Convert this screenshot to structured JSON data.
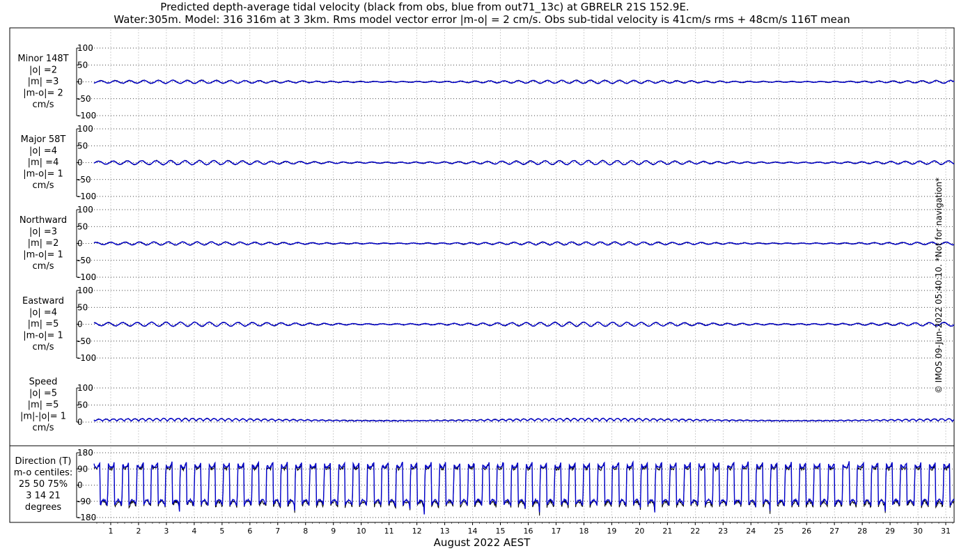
{
  "header": {
    "title": "Predicted depth-average tidal velocity (black from obs, blue from out71_13c) at GBRELR 21S 152.9E.",
    "subtitle": "Water:305m. Model: 316 316m at 3 3km. Rms model vector error |m-o| = 2 cm/s. Obs sub-tidal velocity is 41cm/s rms + 48cm/s 116T mean"
  },
  "footer": {
    "xlabel": "August 2022 AEST",
    "copyright": "© IMOS 09-Jun-2022 05:40:10. *Not for navigation*"
  },
  "colors": {
    "observed": "#000000",
    "model": "#0000cc",
    "grid": "#b0b0b0"
  },
  "chart_data": [
    {
      "type": "line",
      "id": "minor",
      "label_lines": [
        "Minor 148T",
        "|o| =2",
        "|m| =3",
        "|m-o|= 2",
        "cm/s"
      ],
      "yticks": [
        "100",
        "50",
        "0",
        "-50",
        "-100"
      ],
      "ytick_values": [
        100,
        50,
        0,
        -50,
        -100
      ],
      "ylim": [
        -100,
        100
      ],
      "amplitude": 3,
      "series": [
        {
          "role": "observed"
        },
        {
          "role": "model"
        }
      ]
    },
    {
      "type": "line",
      "id": "major",
      "label_lines": [
        "Major 58T",
        "|o| =4",
        "|m| =4",
        "|m-o|= 1",
        "cm/s"
      ],
      "yticks": [
        "100",
        "50",
        "0",
        "-50",
        "-100"
      ],
      "ytick_values": [
        100,
        50,
        0,
        -50,
        -100
      ],
      "ylim": [
        -100,
        100
      ],
      "amplitude": 4,
      "series": [
        {
          "role": "observed"
        },
        {
          "role": "model"
        }
      ]
    },
    {
      "type": "line",
      "id": "northward",
      "label_lines": [
        "Northward",
        "|o| =3",
        "|m| =2",
        "|m-o|= 1",
        "cm/s"
      ],
      "yticks": [
        "100",
        "50",
        "0",
        "-50",
        "-100"
      ],
      "ytick_values": [
        100,
        50,
        0,
        -50,
        -100
      ],
      "ylim": [
        -100,
        100
      ],
      "amplitude": 3,
      "series": [
        {
          "role": "observed"
        },
        {
          "role": "model"
        }
      ]
    },
    {
      "type": "line",
      "id": "eastward",
      "label_lines": [
        "Eastward",
        "|o| =4",
        "|m| =5",
        "|m-o|= 1",
        "cm/s"
      ],
      "yticks": [
        "100",
        "50",
        "0",
        "-50",
        "-100"
      ],
      "ytick_values": [
        100,
        50,
        0,
        -50,
        -100
      ],
      "ylim": [
        -100,
        100
      ],
      "amplitude": 4,
      "series": [
        {
          "role": "observed"
        },
        {
          "role": "model"
        }
      ]
    },
    {
      "type": "line",
      "id": "speed",
      "label_lines": [
        "Speed",
        "|o| =5",
        "|m| =5",
        "|m|-|o|= 1",
        "cm/s"
      ],
      "yticks": [
        "100",
        "50",
        "0"
      ],
      "ytick_values": [
        100,
        50,
        0
      ],
      "ylim": [
        0,
        100
      ],
      "amplitude": 5,
      "series": [
        {
          "role": "observed"
        },
        {
          "role": "model"
        }
      ]
    },
    {
      "type": "line",
      "id": "direction",
      "label_lines": [
        "Direction (T)",
        "m-o centiles:",
        "25  50  75%",
        "3  14  21",
        "degrees"
      ],
      "yticks": [
        "180",
        "90",
        "0",
        "-90",
        "-180"
      ],
      "ytick_values": [
        180,
        90,
        0,
        -90,
        -180
      ],
      "ylim": [
        -180,
        180
      ],
      "series": [
        {
          "role": "observed"
        },
        {
          "role": "model"
        }
      ]
    }
  ],
  "xaxis": {
    "ticks": [
      "1",
      "2",
      "3",
      "4",
      "5",
      "6",
      "7",
      "8",
      "9",
      "10",
      "11",
      "12",
      "13",
      "14",
      "15",
      "16",
      "17",
      "18",
      "19",
      "20",
      "21",
      "22",
      "23",
      "24",
      "25",
      "26",
      "27",
      "28",
      "29",
      "30",
      "31"
    ],
    "xlim_days": [
      0.4,
      31.3
    ]
  }
}
